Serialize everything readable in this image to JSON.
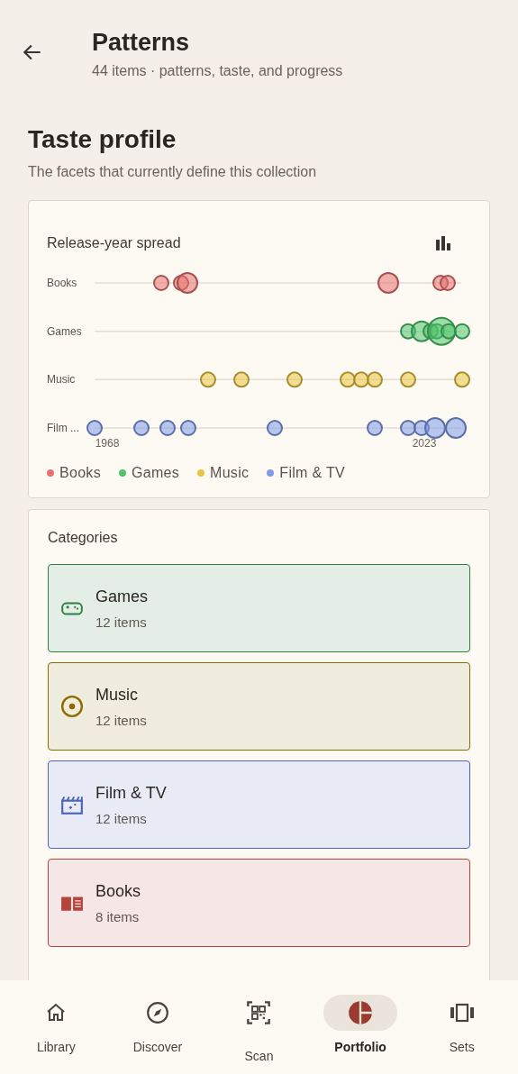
{
  "header": {
    "title": "Patterns",
    "subtitle": "44 items · patterns, taste, and progress"
  },
  "section": {
    "title": "Taste profile",
    "subtitle": "The facets that currently define this collection"
  },
  "spread_card": {
    "title": "Release-year spread",
    "row_labels": [
      "Books",
      "Games",
      "Music",
      "Film ..."
    ],
    "axis_labels": [
      "1968",
      "2023"
    ],
    "legend": [
      {
        "label": "Books",
        "color": "#e8716f"
      },
      {
        "label": "Games",
        "color": "#4fc46b"
      },
      {
        "label": "Music",
        "color": "#e9c53f"
      },
      {
        "label": "Film & TV",
        "color": "#7f9ae8"
      }
    ]
  },
  "categories_card": {
    "title": "Categories",
    "items": [
      {
        "kind": "games",
        "label": "Games",
        "count": "12 items",
        "color": "#2e7d45"
      },
      {
        "kind": "music",
        "label": "Music",
        "count": "12 items",
        "color": "#8a6d00"
      },
      {
        "kind": "film",
        "label": "Film & TV",
        "count": "12 items",
        "color": "#4f63b8"
      },
      {
        "kind": "books",
        "label": "Books",
        "count": "8 items",
        "color": "#b5443a"
      }
    ]
  },
  "nav": [
    {
      "kind": "home",
      "label": "Library",
      "selected": false
    },
    {
      "kind": "compass",
      "label": "Discover",
      "selected": false
    },
    {
      "kind": "scan",
      "label": "Scan",
      "selected": false
    },
    {
      "kind": "pie",
      "label": "Portfolio",
      "selected": true
    },
    {
      "kind": "sets",
      "label": "Sets",
      "selected": false
    }
  ]
}
